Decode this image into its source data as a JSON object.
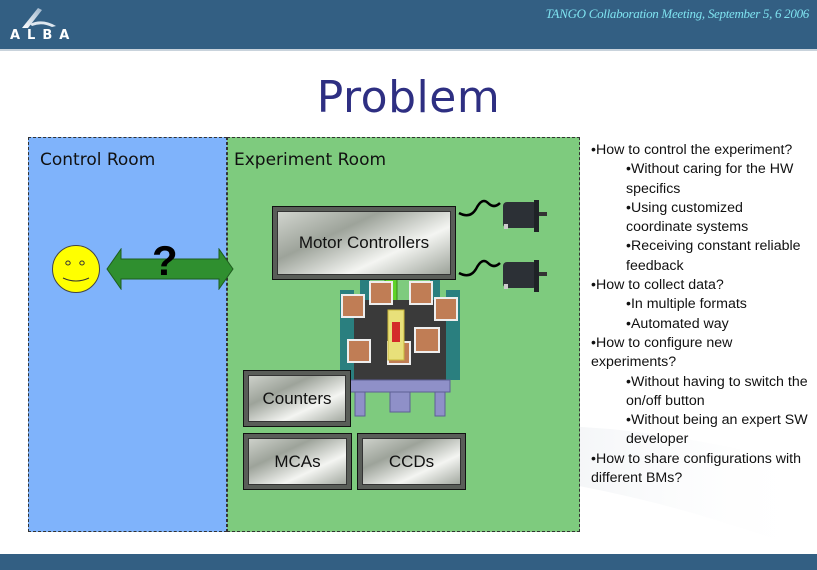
{
  "header": {
    "logo_text": "ALBA",
    "meeting": "TANGO Collaboration Meeting, September 5, 6 2006"
  },
  "slide": {
    "title": "Problem"
  },
  "diagram": {
    "control_room_label": "Control Room",
    "experiment_room_label": "Experiment Room",
    "question_mark": "?",
    "boxes": {
      "motor_controllers": "Motor Controllers",
      "counters": "Counters",
      "mcas": "MCAs",
      "ccds": "CCDs"
    },
    "icons": [
      "smiley-face-icon",
      "double-arrow-icon",
      "motor-icon",
      "motor-icon",
      "detector-instrument-icon"
    ]
  },
  "bullets": [
    {
      "level": 1,
      "text": "•How to control the experiment?"
    },
    {
      "level": 2,
      "text": "•Without caring for the HW specifics"
    },
    {
      "level": 2,
      "text": "•Using customized coordinate systems"
    },
    {
      "level": 2,
      "text": "•Receiving constant reliable feedback"
    },
    {
      "level": 1,
      "text": "•How to collect data?"
    },
    {
      "level": 2,
      "text": "•In multiple formats"
    },
    {
      "level": 2,
      "text": "•Automated way"
    },
    {
      "level": 1,
      "text": "•How to configure new experiments?"
    },
    {
      "level": 2,
      "text": "•Without having to switch the on/off button"
    },
    {
      "level": 2,
      "text": "•Without being an expert SW developer"
    },
    {
      "level": 1,
      "text": "•How to share configurations with different BMs?"
    }
  ],
  "colors": {
    "header_bg": "#335f83",
    "meeting_text": "#7fe3f0",
    "title_text": "#2e2f82",
    "control_room_bg": "#7fb3fb",
    "experiment_room_bg": "#7ecb7e",
    "arrow_green": "#2f8f2f",
    "smiley_yellow": "#ffff00"
  }
}
